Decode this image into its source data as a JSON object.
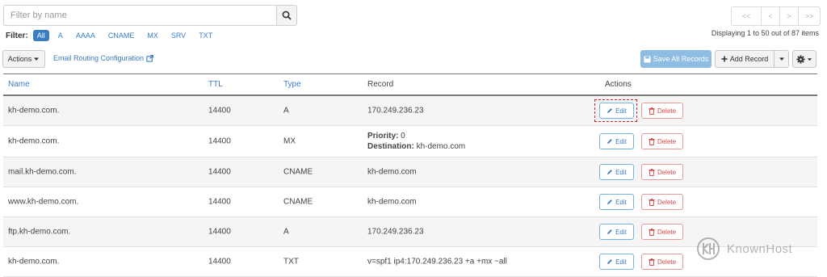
{
  "search": {
    "placeholder": "Filter by name",
    "value": ""
  },
  "pagination": {
    "first": "<<",
    "prev": "<",
    "next": ">",
    "last": ">>",
    "info": "Displaying 1 to 50 out of 87 items"
  },
  "filter": {
    "label": "Filter:",
    "options": [
      "All",
      "A",
      "AAAA",
      "CNAME",
      "MX",
      "SRV",
      "TXT"
    ],
    "active": "All"
  },
  "toolbar": {
    "actions_label": "Actions",
    "email_routing_label": "Email Routing Configuration",
    "save_all_label": "Save All Records",
    "add_record_label": "Add Record"
  },
  "table": {
    "headers": {
      "name": "Name",
      "ttl": "TTL",
      "type": "Type",
      "record": "Record",
      "actions": "Actions"
    },
    "edit_label": "Edit",
    "delete_label": "Delete",
    "rows": [
      {
        "name": "kh-demo.com.",
        "ttl": "14400",
        "type": "A",
        "record": "170.249.236.23"
      },
      {
        "name": "kh-demo.com.",
        "ttl": "14400",
        "type": "MX",
        "priority_label": "Priority:",
        "priority": "0",
        "destination_label": "Destination:",
        "destination": "kh-demo.com"
      },
      {
        "name": "mail.kh-demo.com.",
        "ttl": "14400",
        "type": "CNAME",
        "record": "kh-demo.com"
      },
      {
        "name": "www.kh-demo.com.",
        "ttl": "14400",
        "type": "CNAME",
        "record": "kh-demo.com"
      },
      {
        "name": "ftp.kh-demo.com.",
        "ttl": "14400",
        "type": "A",
        "record": "170.249.236.23"
      },
      {
        "name": "kh-demo.com.",
        "ttl": "14400",
        "type": "TXT",
        "record": "v=spf1 ip4:170.249.236.23 +a +mx ~all"
      }
    ]
  },
  "watermark": {
    "text": "KnownHost"
  },
  "colors": {
    "link": "#3a7cc4",
    "save_button": "#8fbce3",
    "delete": "#d54a4a",
    "highlight": "#d0202a"
  },
  "icons": [
    "search-icon",
    "external-link-icon",
    "save-icon",
    "plus-icon",
    "gear-icon",
    "pencil-icon",
    "trash-icon",
    "caret-down-icon"
  ]
}
